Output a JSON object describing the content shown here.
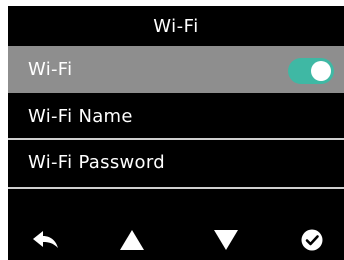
{
  "header": {
    "title": "Wi-Fi"
  },
  "menu": {
    "items": [
      {
        "label": "Wi-Fi",
        "selected": true,
        "toggle_state": "on"
      },
      {
        "label": "Wi-Fi Name",
        "selected": false
      },
      {
        "label": "Wi-Fi Password",
        "selected": false
      }
    ]
  },
  "softkeys": [
    {
      "icon": "back-arrow-icon"
    },
    {
      "icon": "up-triangle-icon"
    },
    {
      "icon": "down-triangle-icon"
    },
    {
      "icon": "confirm-check-icon"
    }
  ],
  "colors": {
    "screen_background": "#000000",
    "selected_row": "#8e8e8e",
    "toggle_on": "#3fb8a4",
    "divider": "#cfcfcf",
    "text": "#ffffff"
  }
}
